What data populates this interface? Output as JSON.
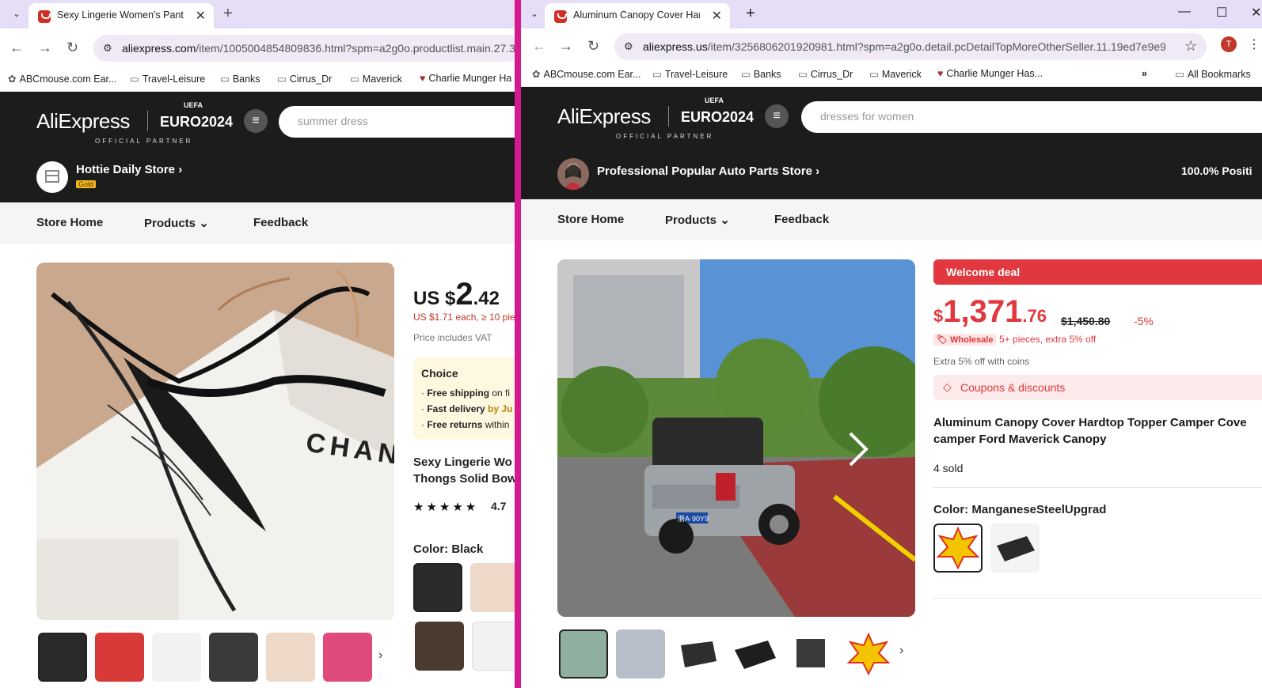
{
  "left": {
    "tab_title": "Sexy Lingerie Women's Panties",
    "url_domain": "aliexpress.com",
    "url_path": "/item/1005004854809836.html?spm=a2g0o.productlist.main.27.3",
    "bookmarks": [
      "ABCmouse.com Ear...",
      "Travel-Leisure",
      "Banks",
      "Cirrus_Dr",
      "Maverick",
      "Charlie Munger Ha"
    ],
    "logo_text": "AliExpress",
    "euro_text": "EURO2024",
    "uefa_text": "UEFA",
    "partner_text": "OFFICIAL PARTNER",
    "search_placeholder": "summer dress",
    "store_name": "Hottie Daily Store",
    "store_badge": "Gold",
    "nav": [
      "Store Home",
      "Products",
      "Feedback"
    ],
    "price_prefix": "US $",
    "price_int": "2",
    "price_dec": ".42",
    "price_bulk": "US $1.71 each, ≥ 10 pie",
    "price_vat": "Price includes VAT",
    "choice_title": "Choice",
    "choice_lines": [
      {
        "bold": "Free shipping",
        "rest": " on fi"
      },
      {
        "bold": "Fast delivery",
        "rest": " by Ju"
      },
      {
        "bold": "Free returns",
        "rest": " within"
      }
    ],
    "title_line1": "Sexy Lingerie Wo",
    "title_line2": "Thongs Solid Bow",
    "rating": "4.7",
    "rating_stars": 4.7,
    "color_label": "Color: Black",
    "thumb_colors": [
      "#2a2a2a",
      "#d83a3a",
      "#f2f2f2",
      "#3a3a3a",
      "#eed9c8",
      "#e04a7a"
    ],
    "image_text": "CHANI"
  },
  "right": {
    "tab_title": "Aluminum Canopy Cover Hardt",
    "url_domain": "aliexpress.us",
    "url_path": "/item/3256806201920981.html?spm=a2g0o.detail.pcDetailTopMoreOtherSeller.11.19ed7e9e9X...",
    "avatar_letter": "T",
    "bookmarks": [
      "ABCmouse.com Ear...",
      "Travel-Leisure",
      "Banks",
      "Cirrus_Dr",
      "Maverick",
      "Charlie Munger Has..."
    ],
    "all_bookmarks": "All Bookmarks",
    "logo_text": "AliExpress",
    "euro_text": "EURO2024",
    "uefa_text": "UEFA",
    "partner_text": "OFFICIAL PARTNER",
    "search_placeholder": "dresses for women",
    "store_name": "Professional Popular Auto Parts Store",
    "store_positive": "100.0% Positi",
    "nav": [
      "Store Home",
      "Products",
      "Feedback"
    ],
    "welcome": "Welcome deal",
    "price_sym": "$",
    "price_int": "1,371",
    "price_dec": ".76",
    "price_old": "$1,450.80",
    "discount": "-5%",
    "wholesale": "Wholesale",
    "wholesale_text": "5+ pieces, extra 5% off",
    "coins": "Extra 5% off with coins",
    "coupons": "Coupons & discounts",
    "title_line1": "Aluminum Canopy Cover Hardtop Topper Camper Cove",
    "title_line2": "camper Ford Maverick Canopy",
    "sold": "4 sold",
    "color_label": "Color: ManganeseSteelUpgrad",
    "plate": "浙A·90Y9",
    "thumb_colors": [
      "#8fb0a0",
      "#b8bec8",
      "#2e2e2e",
      "#1e1e1e",
      "#3a3a3a",
      "#f5c400"
    ]
  }
}
